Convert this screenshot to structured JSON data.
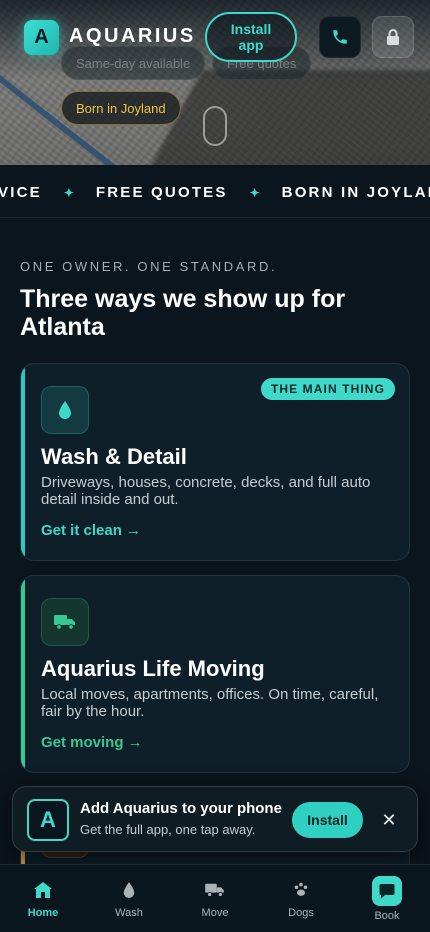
{
  "hero": {
    "chips": [
      "Same-day available",
      "Free quotes",
      "Born in Joyland"
    ]
  },
  "header": {
    "logo_letter": "A",
    "brand": "AQUARIUS",
    "install_label": "Install app",
    "phone_icon": "phone-icon",
    "lock_icon": "lock-icon"
  },
  "marquee": {
    "items": [
      "VICE",
      "FREE QUOTES",
      "BORN IN JOYLAN"
    ]
  },
  "section": {
    "eyebrow": "ONE OWNER. ONE STANDARD.",
    "title": "Three ways we show up for Atlanta"
  },
  "cards": [
    {
      "icon": "water-drop-icon",
      "badge": "THE MAIN THING",
      "title": "Wash & Detail",
      "description": "Driveways, houses, concrete, decks, and full auto detail inside and out.",
      "link": "Get it clean →"
    },
    {
      "icon": "truck-icon",
      "title": "Aquarius Life Moving",
      "description": "Local moves, apartments, offices. On time, careful, fair by the hour.",
      "link": "Get moving →"
    },
    {
      "icon": "paw-icon"
    }
  ],
  "install_banner": {
    "logo_letter": "A",
    "title": "Add Aquarius to your phone",
    "subtitle": "Get the full app, one tap away.",
    "button": "Install",
    "close": "✕"
  },
  "bottom_nav": {
    "items": [
      {
        "label": "Home",
        "icon": "home-icon",
        "active": true
      },
      {
        "label": "Wash",
        "icon": "water-drop-icon"
      },
      {
        "label": "Move",
        "icon": "truck-icon"
      },
      {
        "label": "Dogs",
        "icon": "paw-icon"
      },
      {
        "label": "Book",
        "icon": "chat-icon"
      }
    ]
  },
  "colors": {
    "background": "#0b151d",
    "accent": "#3ed9c9",
    "moving_accent": "#38c993",
    "joyland_chip": "#f0c24b"
  }
}
